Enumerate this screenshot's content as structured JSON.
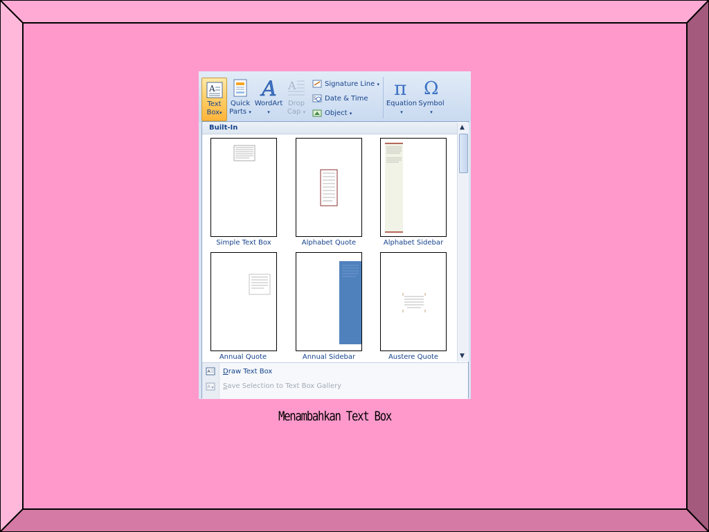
{
  "colors": {
    "slide_background": "#ff99cc",
    "frame_top": "#ffaad4",
    "frame_left": "#ffb8d9",
    "frame_right": "#a35a7c",
    "frame_bottom": "#d57aa5",
    "ribbon_text": "#15428b",
    "selected_button": "#ffd06b",
    "sidebar_blue": "#4f81bd"
  },
  "ribbon": {
    "text_box": {
      "line1": "Text",
      "line2": "Box",
      "icon": "text-box-icon",
      "selected": true
    },
    "quick_parts": {
      "line1": "Quick",
      "line2": "Parts",
      "icon": "quick-parts-icon"
    },
    "wordart": {
      "label": "WordArt",
      "icon": "wordart-icon"
    },
    "drop_cap": {
      "line1": "Drop",
      "line2": "Cap",
      "icon": "drop-cap-icon",
      "disabled": true
    },
    "signature_line": {
      "label": "Signature Line",
      "icon": "signature-line-icon"
    },
    "date_time": {
      "label": "Date & Time",
      "icon": "date-time-icon"
    },
    "object": {
      "label": "Object",
      "icon": "object-icon"
    },
    "equation": {
      "label": "Equation",
      "icon": "pi-icon"
    },
    "symbol": {
      "label": "Symbol",
      "icon": "omega-icon"
    },
    "dropdown_arrow": "▾"
  },
  "gallery": {
    "section_title": "Built-In",
    "items": [
      {
        "label": "Simple Text Box"
      },
      {
        "label": "Alphabet Quote"
      },
      {
        "label": "Alphabet Sidebar"
      },
      {
        "label": "Annual Quote"
      },
      {
        "label": "Annual Sidebar"
      },
      {
        "label": "Austere Quote"
      }
    ],
    "scroll_up": "▲",
    "scroll_down": "▼"
  },
  "footer": {
    "draw_text_box": {
      "accel": "D",
      "rest": "raw Text Box"
    },
    "save_selection": {
      "accel": "S",
      "rest": "ave Selection to Text Box Gallery",
      "disabled": true
    }
  },
  "caption": "Menambahkan Text Box"
}
